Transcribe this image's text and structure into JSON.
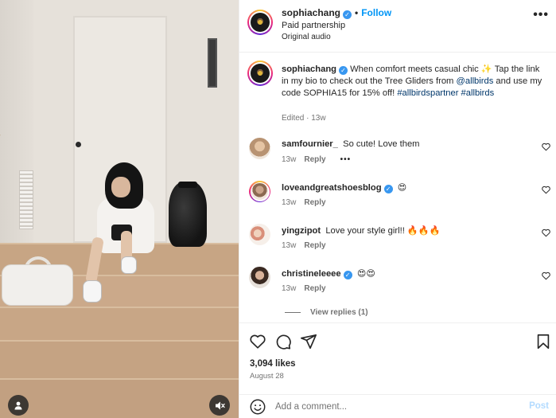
{
  "post": {
    "username": "sophiachang",
    "follow_label": "Follow",
    "separator": "•",
    "subtitle": "Paid partnership",
    "audio": "Original audio",
    "more_label": "•••"
  },
  "caption": {
    "username": "sophiachang",
    "text_part1": "When comfort meets casual chic ✨ Tap the link in my bio to check out the Tree Gliders from ",
    "mention": "@allbirds",
    "text_part2": " and use my code SOPHIA15 for 15% off! ",
    "hashtag1": "#allbirdspartner",
    "hashtag2": "#allbirds",
    "edited": "Edited",
    "meta_sep": " · ",
    "age": "13w"
  },
  "comments": [
    {
      "username": "samfournier_",
      "verified": false,
      "text": "So cute! Love them",
      "age": "13w",
      "reply_label": "Reply",
      "more": "•••"
    },
    {
      "username": "loveandgreatshoesblog",
      "verified": true,
      "text": "😍",
      "age": "13w",
      "reply_label": "Reply"
    },
    {
      "username": "yingzipot",
      "verified": false,
      "text": "Love your style girl!! 🔥🔥🔥",
      "age": "13w",
      "reply_label": "Reply"
    },
    {
      "username": "christineleeee",
      "verified": true,
      "text": "😍😍",
      "age": "13w",
      "reply_label": "Reply"
    }
  ],
  "view_replies": "View replies (1)",
  "likes": "3,094 likes",
  "post_date": "August 28",
  "comment_box": {
    "placeholder": "Add a comment...",
    "post_label": "Post"
  },
  "colors": {
    "link_blue": "#0095f6",
    "verified_blue": "#3897f0",
    "muted_text": "#737373"
  }
}
